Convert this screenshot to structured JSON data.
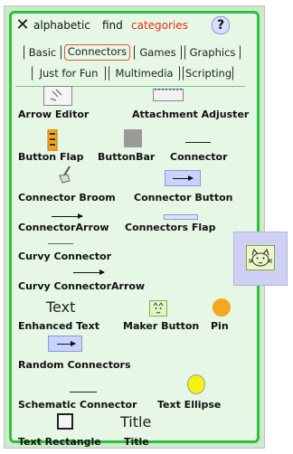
{
  "header": {
    "alphabetic_label": "alphabetic",
    "find_label": "find",
    "categories_label": "categories",
    "help_label": "?"
  },
  "tabs": [
    {
      "label": "Basic",
      "active": false
    },
    {
      "label": "Connectors",
      "active": true
    },
    {
      "label": "Games",
      "active": false
    },
    {
      "label": "Graphics",
      "active": false
    },
    {
      "label": "Just for Fun",
      "active": false
    },
    {
      "label": "Multimedia",
      "active": false
    },
    {
      "label": "Scripting",
      "active": false
    }
  ],
  "items": {
    "arrow_editor": "Arrow Editor",
    "attachment_adjuster": "Attachment Adjuster",
    "button_flap": "Button Flap",
    "buttonbar": "ButtonBar",
    "connector": "Connector",
    "connector_broom": "Connector Broom",
    "connector_button": "Connector Button",
    "connector_arrow": "ConnectorArrow",
    "connectors_flap": "Connectors Flap",
    "curvy_connector": "Curvy Connector",
    "curvy_connector_arrow": "Curvy ConnectorArrow",
    "enhanced_text": "Enhanced Text",
    "enhanced_text_sample": "Text",
    "maker_button": "Maker Button",
    "pin": "Pin",
    "random_connectors": "Random Connectors",
    "schematic_connector": "Schematic Connector",
    "text_ellipse": "Text Ellipse",
    "text_rectangle": "Text Rectangle",
    "title": "Title",
    "title_sample": "Title"
  },
  "colors": {
    "flap_border": "#2fc13a",
    "flap_background": "#e6f7e6",
    "categories_text": "#e0311d",
    "active_tab_border": "#e05a2f",
    "pin": "#f5a623",
    "ellipse": "#f7f014"
  },
  "icons": [
    "close-icon",
    "help-icon",
    "cat-icon"
  ]
}
